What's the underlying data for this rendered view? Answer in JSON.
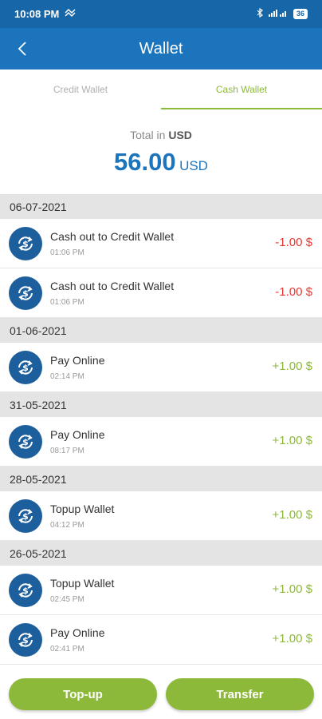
{
  "status_bar": {
    "time": "10:08 PM",
    "battery": "36"
  },
  "header": {
    "title": "Wallet"
  },
  "tabs": [
    {
      "label": "Credit Wallet",
      "active": false
    },
    {
      "label": "Cash Wallet",
      "active": true
    }
  ],
  "total": {
    "label": "Total in",
    "currency_label": "USD",
    "amount": "56.00",
    "currency": "USD"
  },
  "groups": [
    {
      "date": "06-07-2021",
      "items": [
        {
          "name": "Cash out to Credit Wallet",
          "time": "01:06 PM",
          "amount": "-1.00 $",
          "type": "neg"
        },
        {
          "name": "Cash out to Credit Wallet",
          "time": "01:06 PM",
          "amount": "-1.00 $",
          "type": "neg"
        }
      ]
    },
    {
      "date": "01-06-2021",
      "items": [
        {
          "name": "Pay Online",
          "time": "02:14 PM",
          "amount": "+1.00 $",
          "type": "pos"
        }
      ]
    },
    {
      "date": "31-05-2021",
      "items": [
        {
          "name": "Pay Online",
          "time": "08:17 PM",
          "amount": "+1.00 $",
          "type": "pos"
        }
      ]
    },
    {
      "date": "28-05-2021",
      "items": [
        {
          "name": "Topup Wallet",
          "time": "04:12 PM",
          "amount": "+1.00 $",
          "type": "pos"
        }
      ]
    },
    {
      "date": "26-05-2021",
      "items": [
        {
          "name": "Topup Wallet",
          "time": "02:45 PM",
          "amount": "+1.00 $",
          "type": "pos"
        },
        {
          "name": "Pay Online",
          "time": "02:41 PM",
          "amount": "+1.00 $",
          "type": "pos"
        }
      ]
    }
  ],
  "actions": {
    "topup_label": "Top-up",
    "transfer_label": "Transfer"
  },
  "colors": {
    "primary": "#1c75bc",
    "accent_green": "#8db93b",
    "negative": "#e53935"
  }
}
